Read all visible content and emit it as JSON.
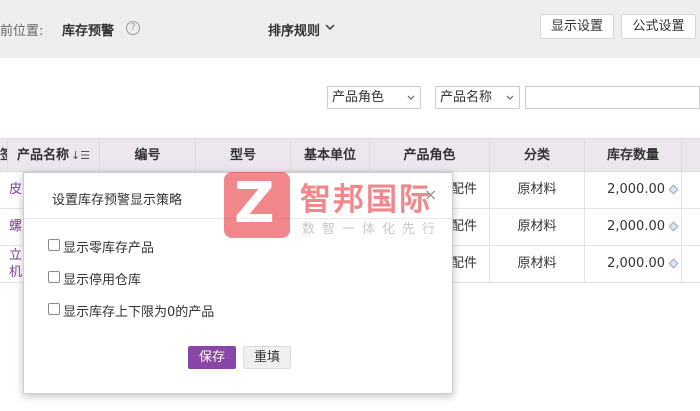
{
  "header": {
    "breadcrumb_prefix": "前位置:",
    "breadcrumb_current": "库存预警",
    "help_icon": "?",
    "sort_rule_label": "排序规则",
    "display_settings_label": "显示设置",
    "formula_settings_label": "公式设置"
  },
  "filters": {
    "role_select": "产品角色",
    "name_select": "产品名称",
    "search_value": ""
  },
  "table": {
    "edge_header": "签",
    "columns": [
      "产品名称",
      "编号",
      "型号",
      "基本单位",
      "产品角色",
      "分类",
      "库存数量"
    ],
    "sort_icon": "↓☰",
    "rows": [
      {
        "name": "皮",
        "code": "",
        "model": "",
        "unit": "",
        "role": "配件",
        "category": "原材料",
        "qty": "2,000.00"
      },
      {
        "name": "螺",
        "code": "",
        "model": "",
        "unit": "",
        "role": "配件",
        "category": "原材料",
        "qty": "2,000.00"
      },
      {
        "name": "立",
        "name2": "机",
        "code": "",
        "model": "",
        "unit": "",
        "role": "配件",
        "category": "原材料",
        "qty": "2,000.00"
      }
    ]
  },
  "dialog": {
    "title": "设置库存预警显示策略",
    "close_glyph": "×",
    "options": [
      {
        "label": "显示零库存产品",
        "checked": false
      },
      {
        "label": "显示停用仓库",
        "checked": false
      },
      {
        "label": "显示库存上下限为0的产品",
        "checked": false
      }
    ],
    "save_label": "保存",
    "reset_label": "重填"
  },
  "watermark": {
    "logo_letter": "Z",
    "name": "智邦国际",
    "slogan": "数智一体化先行"
  },
  "colors": {
    "accent": "#8a45a8",
    "header_bg": "#ede6ef",
    "watermark_red": "#e6262e"
  }
}
